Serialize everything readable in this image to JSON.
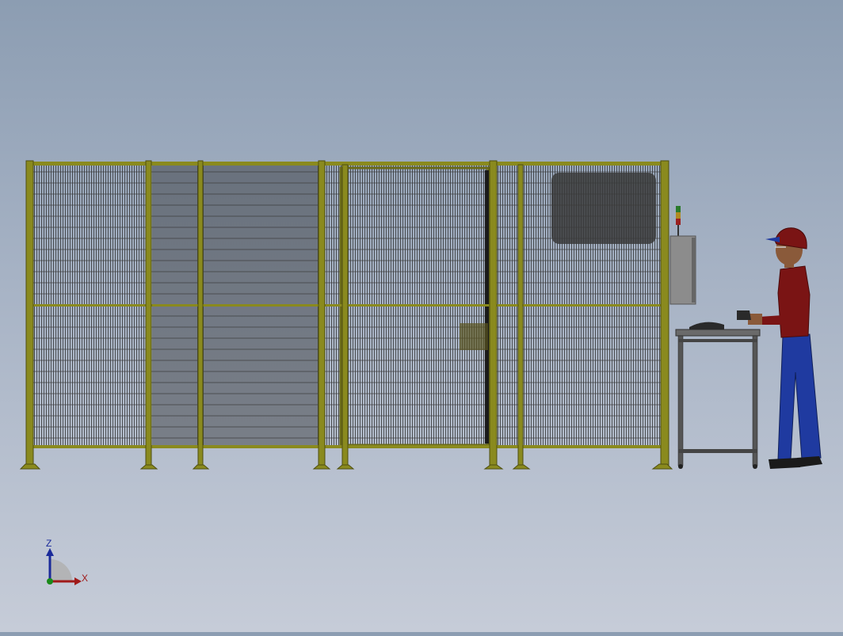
{
  "viewport": {
    "scene": "isometric-cad-view",
    "colors": {
      "frame": "#8a8a1e",
      "frame_dark": "#4f4f10",
      "mesh": "#2a2a2a",
      "worker_shirt": "#7a1414",
      "worker_pants": "#1f3aa0",
      "worker_skin": "#8a5a3a",
      "table": "#555555"
    }
  },
  "triad": {
    "z_label": "Z",
    "x_label": "X",
    "z_color": "#1a2a9a",
    "x_color": "#a01a1a",
    "origin_color": "#1a8a1a"
  }
}
